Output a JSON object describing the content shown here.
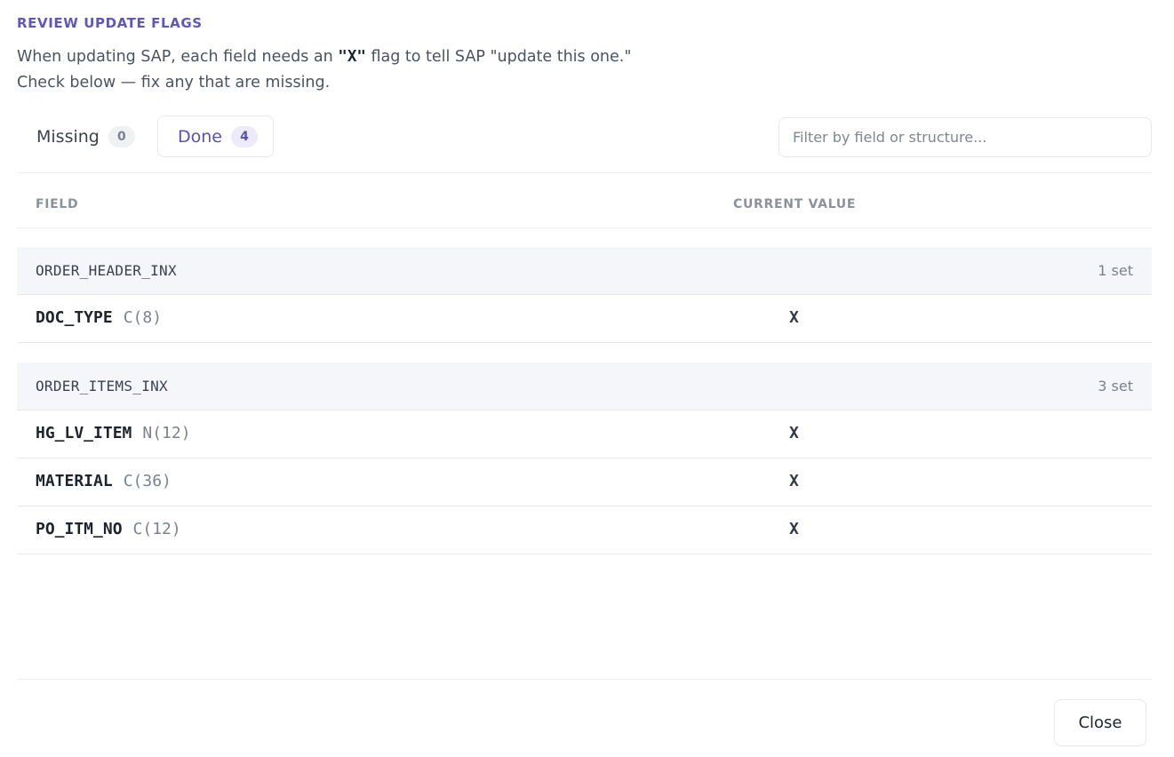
{
  "header": {
    "title": "REVIEW UPDATE FLAGS",
    "desc_before": "When updating SAP, each field needs an ",
    "desc_flag": "\"X\"",
    "desc_after": " flag to tell SAP \"update this one.\"",
    "desc_line2": "Check below — fix any that are missing."
  },
  "tabs": [
    {
      "label": "Missing",
      "count": "0",
      "active": false
    },
    {
      "label": "Done",
      "count": "4",
      "active": true
    }
  ],
  "filter": {
    "placeholder": "Filter by field or structure...",
    "value": ""
  },
  "table": {
    "columns": {
      "field": "FIELD",
      "value": "CURRENT VALUE"
    },
    "groups": [
      {
        "name": "ORDER_HEADER_INX",
        "count": "1 set",
        "rows": [
          {
            "field": "DOC_TYPE",
            "type": "C(8)",
            "value": "X"
          }
        ]
      },
      {
        "name": "ORDER_ITEMS_INX",
        "count": "3 set",
        "rows": [
          {
            "field": "HG_LV_ITEM",
            "type": "N(12)",
            "value": "X"
          },
          {
            "field": "MATERIAL",
            "type": "C(36)",
            "value": "X"
          },
          {
            "field": "PO_ITM_NO",
            "type": "C(12)",
            "value": "X"
          }
        ]
      }
    ]
  },
  "footer": {
    "close_label": "Close"
  },
  "colors": {
    "accent": "#6057b8",
    "group_bg": "#f5f6f9",
    "border": "#e5e7eb"
  }
}
